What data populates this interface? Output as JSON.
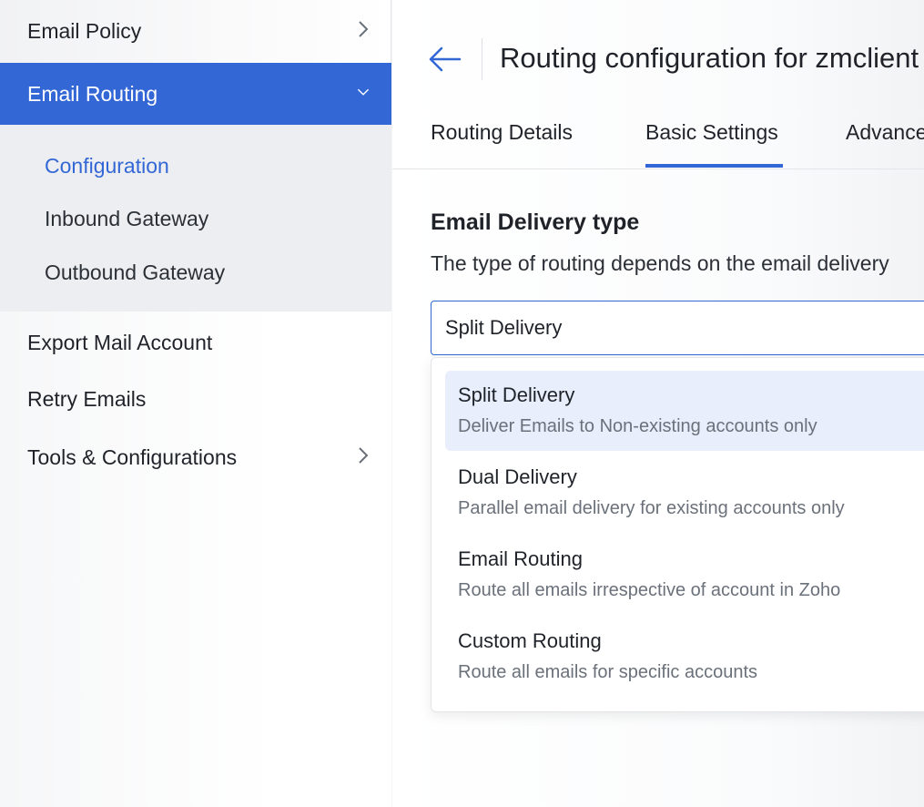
{
  "sidebar": {
    "top_items": [
      {
        "label": "Email Policy"
      },
      {
        "label": "Email Routing"
      }
    ],
    "submenu": [
      {
        "label": "Configuration"
      },
      {
        "label": "Inbound Gateway"
      },
      {
        "label": "Outbound Gateway"
      }
    ],
    "lower_items": [
      {
        "label": "Export Mail Account"
      },
      {
        "label": "Retry Emails"
      },
      {
        "label": "Tools & Configurations"
      }
    ]
  },
  "header": {
    "title": "Routing configuration for zmclient"
  },
  "tabs": [
    {
      "label": "Routing Details"
    },
    {
      "label": "Basic Settings"
    },
    {
      "label": "Advanced"
    }
  ],
  "section": {
    "heading": "Email Delivery type",
    "description": "The type of routing depends on the email delivery"
  },
  "select": {
    "value": "Split Delivery"
  },
  "options": [
    {
      "label": "Split Delivery",
      "desc": "Deliver Emails to Non-existing accounts only"
    },
    {
      "label": "Dual Delivery",
      "desc": "Parallel email delivery for existing accounts only"
    },
    {
      "label": "Email Routing",
      "desc": "Route all emails irrespective of account in Zoho"
    },
    {
      "label": "Custom Routing",
      "desc": "Route all emails for specific accounts"
    }
  ],
  "colors": {
    "accent": "#3367d6",
    "highlight": "#e8eefb"
  }
}
